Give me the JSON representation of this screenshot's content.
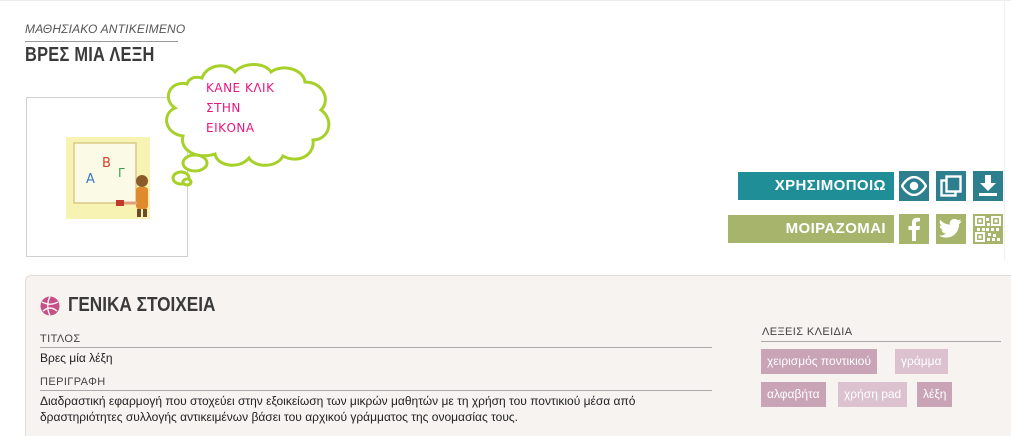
{
  "header": {
    "kicker": "ΜΑΘΗΣΙΑΚΟ ΑΝΤΙΚΕΙΜΕΝΟ",
    "title": "ΒΡΕΣ ΜΙΑ ΛΕΞΗ"
  },
  "preview": {
    "bubble_lines": [
      "ΚΑΝΕ ΚΛΙΚ",
      "ΣΤΗΝ",
      "ΕΙΚΟΝΑ"
    ],
    "letters": [
      "Α",
      "Β",
      "Γ"
    ]
  },
  "actions": {
    "use_label": "ΧΡΗΣΙΜΟΠΟΙΩ",
    "share_label": "ΜΟΙΡΑΖΟΜΑΙ",
    "icons": [
      "eye-icon",
      "copy-icon",
      "download-icon",
      "facebook-icon",
      "twitter-icon",
      "qr-code-icon"
    ],
    "colors": {
      "use": "#1f8e97",
      "use_icons": "#2d7f8e",
      "share": "#a6b46c"
    }
  },
  "details": {
    "section_title": "ΓΕΝΙΚΑ ΣΤΟΙΧΕΙΑ",
    "title_label": "ΤΙΤΛΟΣ",
    "title_value": "Βρες μία λέξη",
    "description_label": "ΠΕΡΙΓΡΑΦΗ",
    "description_value": "Διαδραστική εφαρμογή που στοχεύει στην εξοικείωση των μικρών μαθητών με τη χρήση του ποντικιού μέσα από δραστηριότητες συλλογής αντικειμένων βάσει του αρχικού γράμματος της ονομασίας τους.",
    "keywords_label": "ΛΕΞΕΙΣ ΚΛΕΙΔΙΑ",
    "keywords": [
      "χειρισμός ποντικιού",
      "γράμμα",
      "αλφαβήτα",
      "χρήση pad",
      "λέξη"
    ],
    "tag_color": "#c9a3b6"
  }
}
